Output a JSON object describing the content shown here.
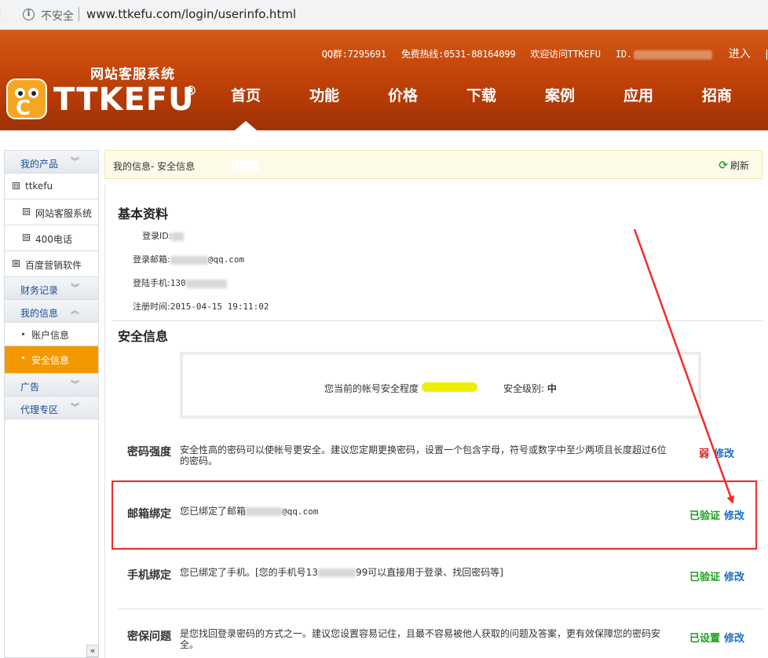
{
  "browser": {
    "security_label": "不安全",
    "url": "www.ttkefu.com/login/userinfo.html"
  },
  "header": {
    "qq": "QQ群:7295691",
    "hotline": "免费热线:0531-88164099",
    "welcome": "欢迎访问TTKEFU",
    "id_label": "ID.",
    "enter": "进入",
    "separator": "|",
    "slogan": "网站客服系统",
    "brand": "TTKEFU",
    "reg_mark": "®",
    "logo_glyph": "C",
    "nav": [
      "首页",
      "功能",
      "价格",
      "下载",
      "案例",
      "应用",
      "招商"
    ]
  },
  "sidebar": {
    "my_products": "我的产品",
    "product": "ttkefu",
    "product_items": [
      "网站客服系统",
      "400电话"
    ],
    "baidu": "百度营销软件",
    "finance": "财务记录",
    "my_info": "我的信息",
    "info_items": [
      "账户信息",
      "安全信息"
    ],
    "ads": "广告",
    "agent": "代理专区",
    "collapse": "«",
    "expand_glyph": "⊟",
    "plus_glyph": "⊞",
    "chev_down": "︾",
    "chev_up": "︽"
  },
  "titlebar": {
    "title": "我的信息- 安全信息",
    "refresh": "刷新",
    "refresh_icon": "⟳"
  },
  "basic": {
    "title": "基本资料",
    "login_id_label": "登录ID:",
    "email_label": "登录邮箱:",
    "email_suffix": "@qq.com",
    "phone_label": "登陆手机:",
    "phone_prefix": "130",
    "reg_time_label": "注册时间:",
    "reg_time": "2015-04-15 19:11:02"
  },
  "security": {
    "title": "安全信息",
    "level_msg": "您当前的帐号安全程度",
    "level_label": "安全级别:",
    "level_value": "中",
    "rows": [
      {
        "name": "密码强度",
        "desc": "安全性高的密码可以使帐号更安全。建议您定期更换密码，设置一个包含字母，符号或数字中至少两项且长度超过6位的密码。",
        "status": "弱",
        "edit": "修改"
      },
      {
        "name": "邮箱绑定",
        "desc_prefix": "您已绑定了邮箱",
        "desc_suffix": "@qq.com",
        "status": "已验证",
        "edit": "修改"
      },
      {
        "name": "手机绑定",
        "desc_prefix": "您已绑定了手机。[您的手机号13",
        "desc_suffix": "99可以直接用于登录、找回密码等]",
        "status": "已验证",
        "edit": "修改"
      },
      {
        "name": "密保问题",
        "desc": "是您找回登录密码的方式之一。建议您设置容易记住，且最不容易被他人获取的问题及答案，更有效保障您的密码安全。",
        "status": "已设置",
        "edit": "修改"
      }
    ]
  },
  "colors": {
    "header_orange": "#c4460b",
    "active_orange": "#f39800",
    "link_blue": "#1e6fc1",
    "status_green": "#1aa11a",
    "weak_red": "#d9261c",
    "annotation_red": "#f42b2b",
    "level_bar": "#eeee00"
  }
}
